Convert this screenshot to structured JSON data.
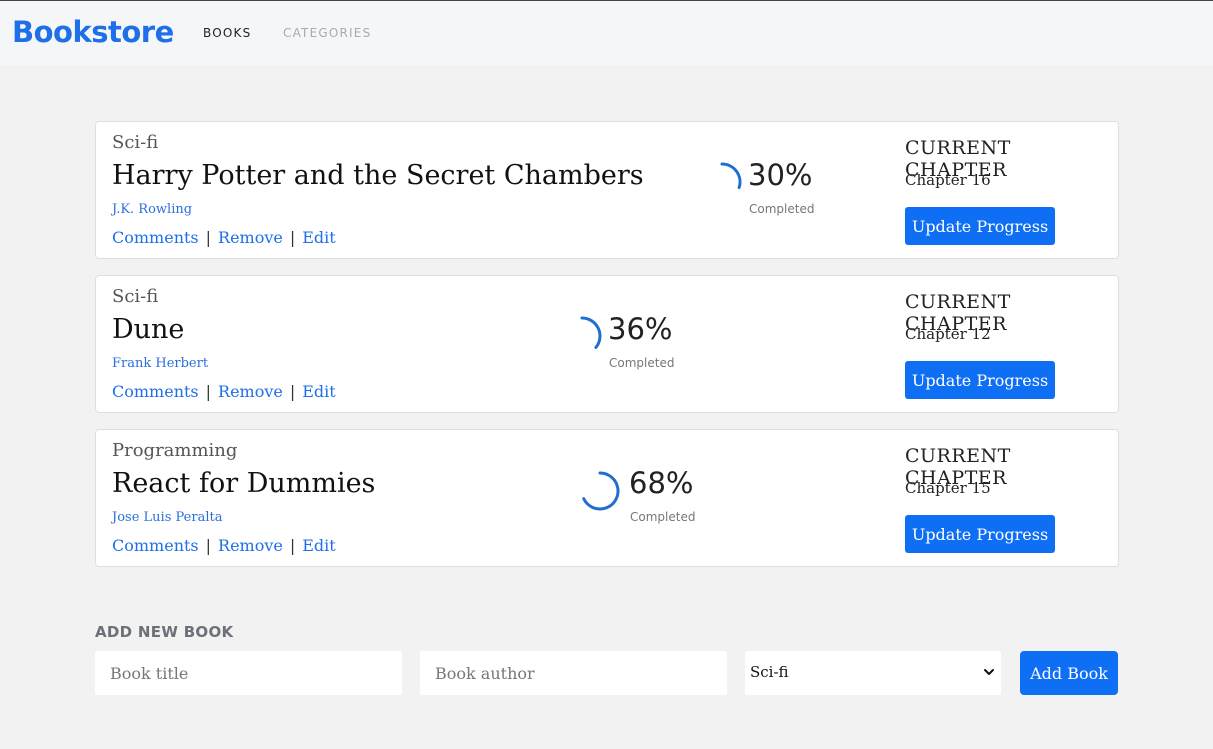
{
  "header": {
    "brand": "Bookstore",
    "nav": [
      {
        "label": "BOOKS"
      },
      {
        "label": "CATEGORIES"
      }
    ]
  },
  "colors": {
    "accent": "#0e6ff5",
    "brand": "#1e6fe8",
    "background": "#f2f2f2"
  },
  "books": [
    {
      "category": "Sci-fi",
      "title": "Harry Potter and the Secret Chambers",
      "author": "J.K. Rowling",
      "actions": {
        "comments": "Comments",
        "remove": "Remove",
        "edit": "Edit",
        "separator": "|"
      },
      "progress_value": 0.3,
      "progress_text": "30%",
      "completed_label": "Completed",
      "chapter_label": "CURRENT CHAPTER",
      "chapter": "Chapter 16",
      "update_label": "Update Progress"
    },
    {
      "category": "Sci-fi",
      "title": "Dune",
      "author": "Frank Herbert",
      "actions": {
        "comments": "Comments",
        "remove": "Remove",
        "edit": "Edit",
        "separator": "|"
      },
      "progress_value": 0.36,
      "progress_text": "36%",
      "completed_label": "Completed",
      "chapter_label": "CURRENT CHAPTER",
      "chapter": "Chapter 12",
      "update_label": "Update Progress"
    },
    {
      "category": "Programming",
      "title": "React for Dummies",
      "author": "Jose Luis Peralta",
      "actions": {
        "comments": "Comments",
        "remove": "Remove",
        "edit": "Edit",
        "separator": "|"
      },
      "progress_value": 0.68,
      "progress_text": "68%",
      "completed_label": "Completed",
      "chapter_label": "CURRENT CHAPTER",
      "chapter": "Chapter 15",
      "update_label": "Update Progress"
    }
  ],
  "add_book": {
    "heading": "ADD NEW BOOK",
    "title_placeholder": "Book title",
    "author_placeholder": "Book author",
    "category_selected": "Sci-fi",
    "submit_label": "Add Book"
  }
}
